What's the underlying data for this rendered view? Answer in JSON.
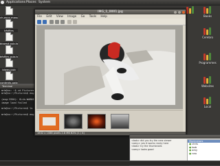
{
  "top_panel": {
    "menus": [
      "Applications",
      "Places",
      "System"
    ],
    "clock": ""
  },
  "desktop_icons": [
    {
      "label": "ch-asus-mass.pub"
    },
    {
      "label": "bfsfiles"
    },
    {
      "label": "blowsd.pub.txt"
    },
    {
      "label": "bfsfiles.pub.txt"
    },
    {
      "label": "blows.pub"
    },
    {
      "label": "contents.patch"
    }
  ],
  "launchers": [
    {
      "label": ""
    },
    {
      "label": "Books"
    },
    {
      "label": "Cerebro"
    },
    {
      "label": "Programmes"
    },
    {
      "label": "Websites"
    },
    {
      "label": "Local"
    }
  ],
  "viewer": {
    "title": "IMG_1_0001.jpg",
    "menu": [
      "File",
      "Edit",
      "View",
      "Image",
      "Go",
      "Tools",
      "Help"
    ],
    "thumbnails": [
      "orange-framed",
      "rocks",
      "embers",
      "dark-landscape"
    ],
    "status": "1632 x 1088 pixels  2.8 MB  62%  (1 / 4)"
  },
  "terminal": {
    "title": "Terminal",
    "lines": [
      "mrb@nx: ~$ cd Pictures",
      "mrb@nx:~/Pictures$ eog",
      "",
      "(eog:3350): GLib-WARNING **: ",
      "image load failed",
      "",
      "mrb@nx:~/Pictures$ ls",
      "",
      "mrb@nx:~/Pictures$ eog ."
    ]
  },
  "chat": {
    "log_lines": [
      "<bob> did you try the new viewer",
      "<amy> yes it works nicely here",
      "<bob> try the thumbnails",
      "<amy> looks good"
    ],
    "users_header": "Moderators",
    "users": [
      "chris",
      "bob",
      "amy",
      "neo"
    ]
  }
}
